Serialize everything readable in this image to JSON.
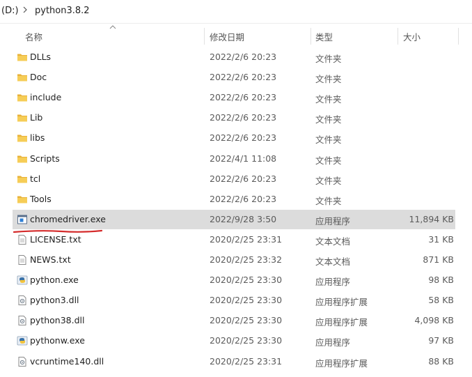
{
  "breadcrumb": {
    "drive": "(D:)",
    "folder": "python3.8.2"
  },
  "columns": {
    "name": "名称",
    "date": "修改日期",
    "type": "类型",
    "size": "大小"
  },
  "files": [
    {
      "name": "DLLs",
      "date": "2022/2/6 20:23",
      "type": "文件夹",
      "size": "",
      "icon": "folder-icon"
    },
    {
      "name": "Doc",
      "date": "2022/2/6 20:23",
      "type": "文件夹",
      "size": "",
      "icon": "folder-icon"
    },
    {
      "name": "include",
      "date": "2022/2/6 20:23",
      "type": "文件夹",
      "size": "",
      "icon": "folder-icon"
    },
    {
      "name": "Lib",
      "date": "2022/2/6 20:23",
      "type": "文件夹",
      "size": "",
      "icon": "folder-icon"
    },
    {
      "name": "libs",
      "date": "2022/2/6 20:23",
      "type": "文件夹",
      "size": "",
      "icon": "folder-icon"
    },
    {
      "name": "Scripts",
      "date": "2022/4/1 11:08",
      "type": "文件夹",
      "size": "",
      "icon": "folder-icon"
    },
    {
      "name": "tcl",
      "date": "2022/2/6 20:23",
      "type": "文件夹",
      "size": "",
      "icon": "folder-icon"
    },
    {
      "name": "Tools",
      "date": "2022/2/6 20:23",
      "type": "文件夹",
      "size": "",
      "icon": "folder-icon"
    },
    {
      "name": "chromedriver.exe",
      "date": "2022/9/28 3:50",
      "type": "应用程序",
      "size": "11,894 KB",
      "icon": "exe-icon",
      "selected": true
    },
    {
      "name": "LICENSE.txt",
      "date": "2020/2/25 23:31",
      "type": "文本文档",
      "size": "31 KB",
      "icon": "text-file-icon"
    },
    {
      "name": "NEWS.txt",
      "date": "2020/2/25 23:32",
      "type": "文本文档",
      "size": "871 KB",
      "icon": "text-file-icon"
    },
    {
      "name": "python.exe",
      "date": "2020/2/25 23:30",
      "type": "应用程序",
      "size": "98 KB",
      "icon": "python-icon"
    },
    {
      "name": "python3.dll",
      "date": "2020/2/25 23:30",
      "type": "应用程序扩展",
      "size": "58 KB",
      "icon": "dll-icon"
    },
    {
      "name": "python38.dll",
      "date": "2020/2/25 23:30",
      "type": "应用程序扩展",
      "size": "4,098 KB",
      "icon": "dll-icon"
    },
    {
      "name": "pythonw.exe",
      "date": "2020/2/25 23:30",
      "type": "应用程序",
      "size": "97 KB",
      "icon": "python-icon"
    },
    {
      "name": "vcruntime140.dll",
      "date": "2020/2/25 23:31",
      "type": "应用程序扩展",
      "size": "88 KB",
      "icon": "dll-icon"
    }
  ],
  "colors": {
    "folder": "#f3c54b",
    "selection": "#dcdcdc",
    "annotation": "#d42a2a"
  }
}
